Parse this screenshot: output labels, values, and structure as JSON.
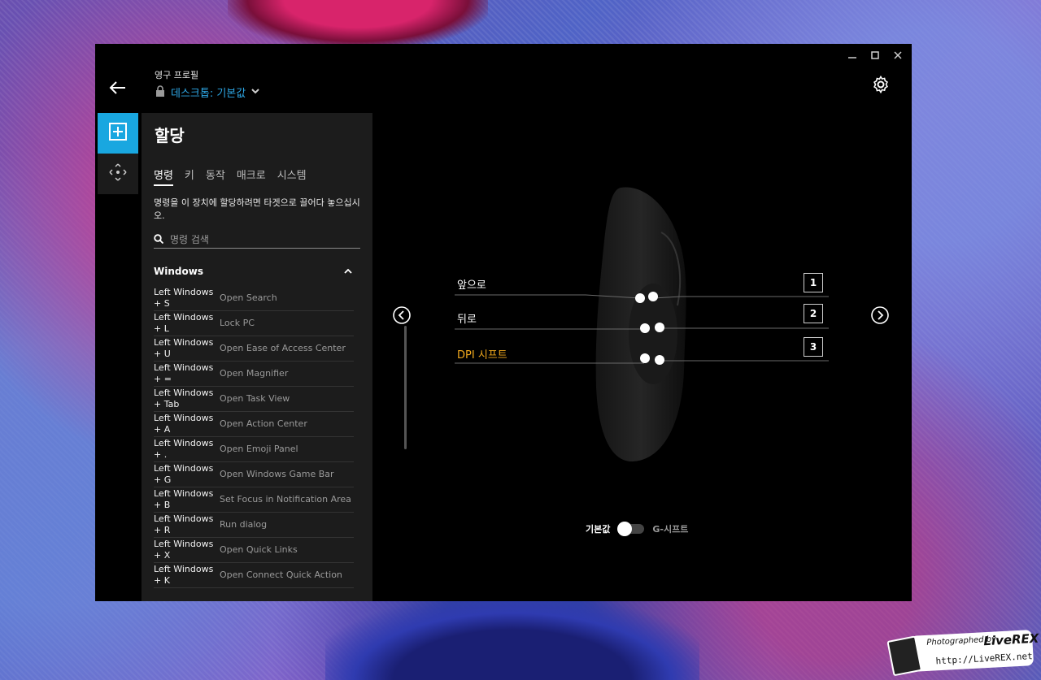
{
  "header": {
    "profile_label": "영구 프로필",
    "profile_name": "데스크톱: 기본값"
  },
  "panel": {
    "title": "할당",
    "tabs": [
      "명령",
      "키",
      "동작",
      "매크로",
      "시스템"
    ],
    "hint": "명령을 이 장치에 할당하려면 타겟으로 끌어다 놓으십시오.",
    "search_placeholder": "명령 검색",
    "group": "Windows",
    "commands": [
      {
        "key": "Left Windows + S",
        "desc": "Open Search"
      },
      {
        "key": "Left Windows + L",
        "desc": "Lock PC"
      },
      {
        "key": "Left Windows + U",
        "desc": "Open Ease of Access Center"
      },
      {
        "key": "Left Windows + =",
        "desc": "Open Magnifier"
      },
      {
        "key": "Left Windows + Tab",
        "desc": "Open Task View"
      },
      {
        "key": "Left Windows + A",
        "desc": "Open Action Center"
      },
      {
        "key": "Left Windows + .",
        "desc": "Open Emoji Panel"
      },
      {
        "key": "Left Windows + G",
        "desc": "Open Windows Game Bar"
      },
      {
        "key": "Left Windows + B",
        "desc": "Set Focus in Notification Area"
      },
      {
        "key": "Left Windows + R",
        "desc": "Run dialog"
      },
      {
        "key": "Left Windows + X",
        "desc": "Open Quick Links"
      },
      {
        "key": "Left Windows + K",
        "desc": "Open Connect Quick Action"
      }
    ]
  },
  "mouse": {
    "callouts": [
      {
        "label": "앞으로",
        "num": "1"
      },
      {
        "label": "뒤로",
        "num": "2"
      },
      {
        "label": "DPI 시프트",
        "num": "3"
      }
    ]
  },
  "toggle": {
    "left_label": "기본값",
    "right_label": "G-시프트"
  },
  "watermark": {
    "line1": "Photographed by",
    "brand": "LiveREX",
    "url": "http://LiveREX.net"
  },
  "colors": {
    "accent": "#19a7e0",
    "highlight": "#f0a81d",
    "background": "#000000"
  }
}
